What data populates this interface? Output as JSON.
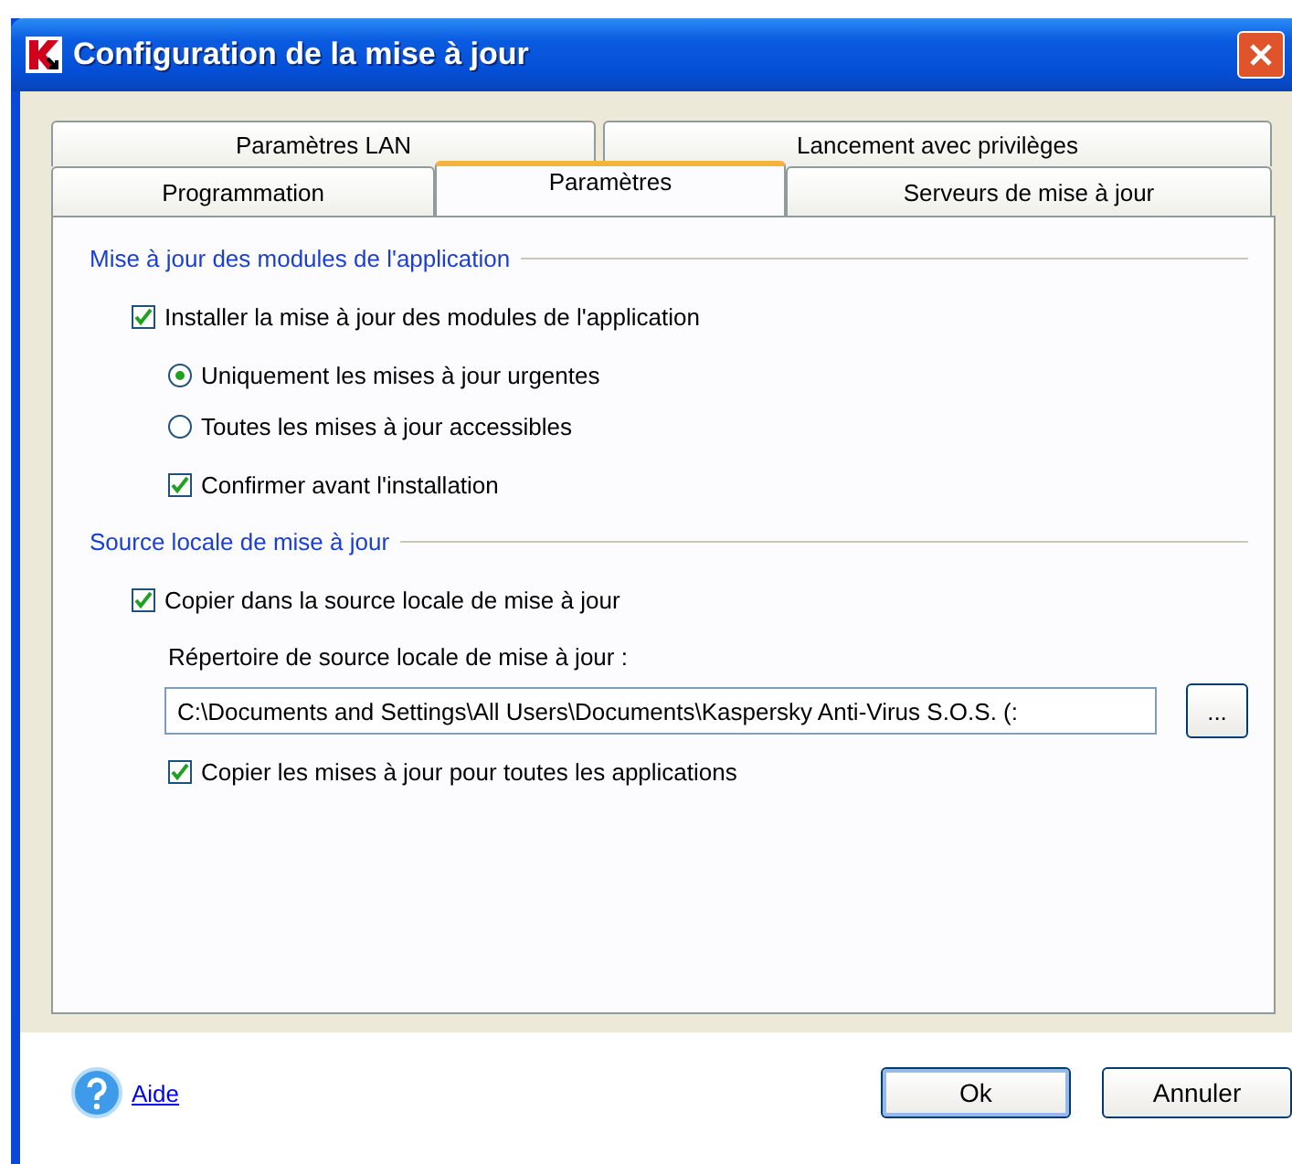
{
  "window": {
    "title": "Configuration de la mise à jour"
  },
  "tab_rows": [
    {
      "tabs": [
        {
          "label": "Paramètres LAN",
          "selected": false
        },
        {
          "label": "Lancement avec privilèges",
          "selected": false
        }
      ]
    },
    {
      "tabs": [
        {
          "label": "Programmation",
          "selected": false
        },
        {
          "label": "Paramètres",
          "selected": true
        },
        {
          "label": "Serveurs de mise à jour",
          "selected": false
        }
      ]
    }
  ],
  "sections": [
    {
      "title": "Mise à jour des modules de l'application",
      "items": [
        {
          "kind": "checkbox",
          "label": "Installer la mise à jour des modules de l'application",
          "checked": true,
          "children": [
            {
              "kind": "radio",
              "label": "Uniquement les mises à jour urgentes",
              "selected": true
            },
            {
              "kind": "radio",
              "label": "Toutes les mises à jour accessibles",
              "selected": false
            },
            {
              "kind": "checkbox",
              "label": "Confirmer avant l'installation",
              "checked": true
            }
          ]
        }
      ]
    },
    {
      "title": "Source locale de mise à jour",
      "items": [
        {
          "kind": "checkbox",
          "label": "Copier dans la source locale de mise à jour",
          "checked": true,
          "children": [
            {
              "kind": "path",
              "label": "Répertoire de source locale de mise à jour :",
              "value": "C:\\Documents and Settings\\All Users\\Documents\\Kaspersky Anti-Virus S.O.S. (:",
              "button": "..."
            },
            {
              "kind": "checkbox",
              "label": "Copier les mises à jour pour toutes les applications",
              "checked": true
            }
          ]
        }
      ]
    }
  ],
  "footer": {
    "help": "Aide",
    "buttons": [
      "Ok",
      "Annuler"
    ]
  }
}
